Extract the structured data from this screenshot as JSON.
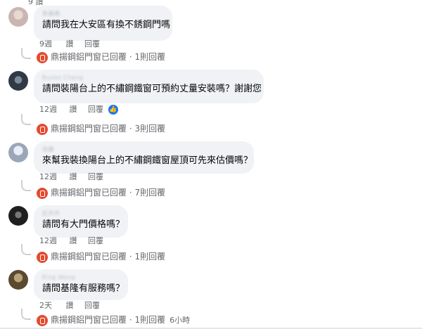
{
  "top_fragment": "9 讚",
  "comments": [
    {
      "author": "朱晨媽",
      "text": "請問我在大安區有換不銹鋼門嗎",
      "time": "9週",
      "like_label": "讚",
      "reply_label": "回覆",
      "page_name": "鼎揚鋼鋁門窗",
      "replied_text": "已回覆",
      "sep": " · ",
      "reply_count": "1則回覆",
      "avatar_color": "#c9b6b0"
    },
    {
      "author": "Busho Cheng",
      "text": "請問裝陽台上的不繡鋼鐵窗可預約丈量安裝嗎？謝謝您",
      "time": "12週",
      "like_label": "讚",
      "reply_label": "回覆",
      "page_name": "鼎揚鋼鋁門窗",
      "replied_text": "已回覆",
      "sep": " · ",
      "reply_count": "3則回覆",
      "avatar_color": "#3c4b5a"
    },
    {
      "author": "佳蓁",
      "text": "來幫我裝換陽台上的不繡鋼鐵窗屋頂可先來估價嗎？",
      "time": "12週",
      "like_label": "讚",
      "reply_label": "回覆",
      "page_name": "鼎揚鋼鋁門窗",
      "replied_text": "已回覆",
      "sep": " · ",
      "reply_count": "7則回覆",
      "avatar_color": "#9aa7b8"
    },
    {
      "author": "紅卉卉",
      "text": "請問有大門價格嗎？",
      "time": "12週",
      "like_label": "讚",
      "reply_label": "回覆",
      "page_name": "鼎揚鋼鋁門窗",
      "replied_text": "已回覆",
      "sep": " · ",
      "reply_count": "1則回覆",
      "avatar_color": "#2b2b2b"
    },
    {
      "author": "King Wang",
      "text": "請問基隆有服務嗎？",
      "time": "2天",
      "like_label": "讚",
      "reply_label": "回覆",
      "page_name": "鼎揚鋼鋁門窗",
      "replied_text": "已回覆",
      "sep": " · ",
      "reply_count": "1則回覆",
      "extra_time": "6小時",
      "avatar_color": "#6b5a3c"
    }
  ]
}
